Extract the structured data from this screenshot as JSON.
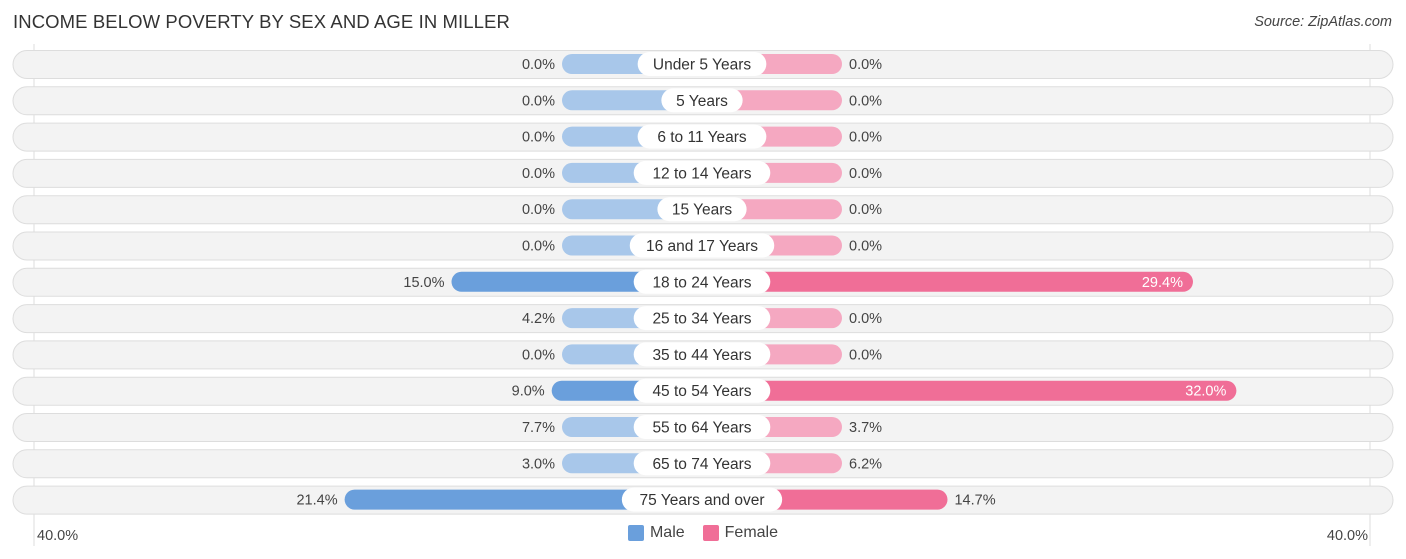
{
  "header": {
    "title": "INCOME BELOW POVERTY BY SEX AND AGE IN MILLER",
    "source": "Source: ZipAtlas.com"
  },
  "colors": {
    "male_strong": "#6a9fdc",
    "male_light": "#a8c7ea",
    "female_strong": "#f06e97",
    "female_light": "#f5a8c1",
    "row_bg": "#f3f3f3",
    "row_border": "#dddddd"
  },
  "chart_data": {
    "type": "bar",
    "orientation": "horizontal-diverging",
    "title": "INCOME BELOW POVERTY BY SEX AND AGE IN MILLER",
    "categories": [
      "Under 5 Years",
      "5 Years",
      "6 to 11 Years",
      "12 to 14 Years",
      "15 Years",
      "16 and 17 Years",
      "18 to 24 Years",
      "25 to 34 Years",
      "35 to 44 Years",
      "45 to 54 Years",
      "55 to 64 Years",
      "65 to 74 Years",
      "75 Years and over"
    ],
    "series": [
      {
        "name": "Male",
        "values": [
          0.0,
          0.0,
          0.0,
          0.0,
          0.0,
          0.0,
          15.0,
          4.2,
          0.0,
          9.0,
          7.7,
          3.0,
          21.4
        ],
        "labels": [
          "0.0%",
          "0.0%",
          "0.0%",
          "0.0%",
          "0.0%",
          "0.0%",
          "15.0%",
          "4.2%",
          "0.0%",
          "9.0%",
          "7.7%",
          "3.0%",
          "21.4%"
        ]
      },
      {
        "name": "Female",
        "values": [
          0.0,
          0.0,
          0.0,
          0.0,
          0.0,
          0.0,
          29.4,
          0.0,
          0.0,
          32.0,
          3.7,
          6.2,
          14.7
        ],
        "labels": [
          "0.0%",
          "0.0%",
          "0.0%",
          "0.0%",
          "0.0%",
          "0.0%",
          "29.4%",
          "0.0%",
          "0.0%",
          "32.0%",
          "3.7%",
          "6.2%",
          "14.7%"
        ]
      }
    ],
    "xlim": [
      -40,
      40
    ],
    "axis_labels": {
      "left": "40.0%",
      "right": "40.0%"
    },
    "legend": {
      "position": "bottom-center",
      "entries": [
        "Male",
        "Female"
      ]
    },
    "grid": false
  }
}
